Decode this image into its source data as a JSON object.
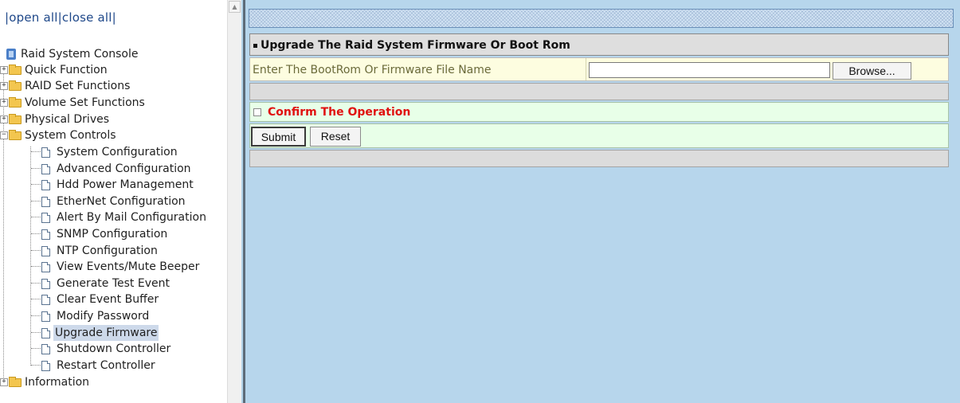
{
  "nav": {
    "open_all": "open all",
    "close_all": "close all",
    "sep": "|",
    "root": "Raid System Console",
    "items": [
      {
        "label": "Quick Function"
      },
      {
        "label": "RAID Set Functions"
      },
      {
        "label": "Volume Set Functions"
      },
      {
        "label": "Physical Drives"
      },
      {
        "label": "System Controls"
      }
    ],
    "children": [
      {
        "label": "System Configuration"
      },
      {
        "label": "Advanced Configuration"
      },
      {
        "label": "Hdd Power Management"
      },
      {
        "label": "EtherNet Configuration"
      },
      {
        "label": "Alert By Mail Configuration"
      },
      {
        "label": "SNMP Configuration"
      },
      {
        "label": "NTP Configuration"
      },
      {
        "label": "View Events/Mute Beeper"
      },
      {
        "label": "Generate Test Event"
      },
      {
        "label": "Clear Event Buffer"
      },
      {
        "label": "Modify Password"
      },
      {
        "label": "Upgrade Firmware"
      },
      {
        "label": "Shutdown Controller"
      },
      {
        "label": "Restart Controller"
      }
    ],
    "last": {
      "label": "Information"
    },
    "selected": "Upgrade Firmware"
  },
  "form": {
    "title": "Upgrade The Raid System Firmware Or Boot Rom",
    "file_label": "Enter The BootRom Or Firmware File Name",
    "file_value": "",
    "browse_label": "Browse...",
    "confirm_label": "Confirm The Operation",
    "submit_label": "Submit",
    "reset_label": "Reset"
  },
  "colors": {
    "confirm_text": "#e01010",
    "content_bg": "#b7d6ec",
    "row_green": "#e8ffe8",
    "row_yellow": "#fdfde0"
  }
}
